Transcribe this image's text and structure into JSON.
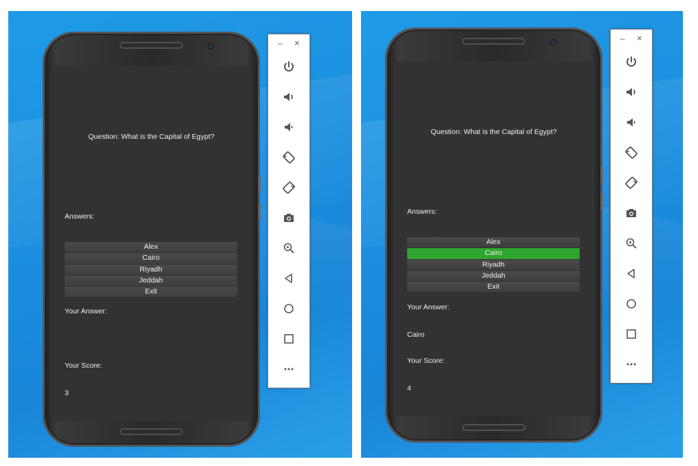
{
  "left": {
    "question": "Question: What is the Capital of Egypt?",
    "answers_label": "Answers:",
    "buttons": [
      "Alex",
      "Cairo",
      "Riyadh",
      "Jeddah",
      "Exit"
    ],
    "your_answer_label": "Your Answer:",
    "your_answer_value": "",
    "your_score_label": "Your Score:",
    "your_score_value": "3"
  },
  "right": {
    "question": "Question: What is the Capital of Egypt?",
    "answers_label": "Answers:",
    "buttons": [
      "Alex",
      "Cairo",
      "Riyadh",
      "Jeddah",
      "Exit"
    ],
    "selected": "Cairo",
    "your_answer_label": "Your Answer:",
    "your_answer_value": "Cairo",
    "your_score_label": "Your Score:",
    "your_score_value": "4"
  },
  "toolbar": {
    "minimize": "–",
    "close": "×",
    "icons": [
      "power-icon",
      "volume-up-icon",
      "volume-down-icon",
      "rotate-left-icon",
      "rotate-right-icon",
      "camera-icon",
      "zoom-icon",
      "back-icon",
      "home-icon",
      "overview-icon",
      "more-icon"
    ]
  },
  "colors": {
    "desktop": "#1d8fe0",
    "screen": "#323232",
    "selected": "#2ea52e",
    "button": "#444444"
  }
}
